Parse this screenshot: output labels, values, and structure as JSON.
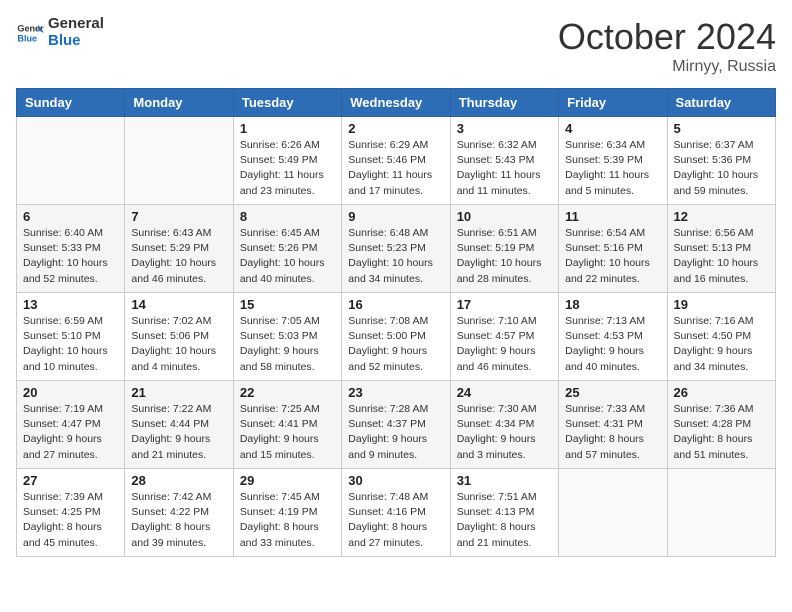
{
  "header": {
    "logo_line1": "General",
    "logo_line2": "Blue",
    "month_title": "October 2024",
    "location": "Mirnyy, Russia"
  },
  "weekdays": [
    "Sunday",
    "Monday",
    "Tuesday",
    "Wednesday",
    "Thursday",
    "Friday",
    "Saturday"
  ],
  "weeks": [
    [
      {
        "day": "",
        "info": ""
      },
      {
        "day": "",
        "info": ""
      },
      {
        "day": "1",
        "info": "Sunrise: 6:26 AM\nSunset: 5:49 PM\nDaylight: 11 hours and 23 minutes."
      },
      {
        "day": "2",
        "info": "Sunrise: 6:29 AM\nSunset: 5:46 PM\nDaylight: 11 hours and 17 minutes."
      },
      {
        "day": "3",
        "info": "Sunrise: 6:32 AM\nSunset: 5:43 PM\nDaylight: 11 hours and 11 minutes."
      },
      {
        "day": "4",
        "info": "Sunrise: 6:34 AM\nSunset: 5:39 PM\nDaylight: 11 hours and 5 minutes."
      },
      {
        "day": "5",
        "info": "Sunrise: 6:37 AM\nSunset: 5:36 PM\nDaylight: 10 hours and 59 minutes."
      }
    ],
    [
      {
        "day": "6",
        "info": "Sunrise: 6:40 AM\nSunset: 5:33 PM\nDaylight: 10 hours and 52 minutes."
      },
      {
        "day": "7",
        "info": "Sunrise: 6:43 AM\nSunset: 5:29 PM\nDaylight: 10 hours and 46 minutes."
      },
      {
        "day": "8",
        "info": "Sunrise: 6:45 AM\nSunset: 5:26 PM\nDaylight: 10 hours and 40 minutes."
      },
      {
        "day": "9",
        "info": "Sunrise: 6:48 AM\nSunset: 5:23 PM\nDaylight: 10 hours and 34 minutes."
      },
      {
        "day": "10",
        "info": "Sunrise: 6:51 AM\nSunset: 5:19 PM\nDaylight: 10 hours and 28 minutes."
      },
      {
        "day": "11",
        "info": "Sunrise: 6:54 AM\nSunset: 5:16 PM\nDaylight: 10 hours and 22 minutes."
      },
      {
        "day": "12",
        "info": "Sunrise: 6:56 AM\nSunset: 5:13 PM\nDaylight: 10 hours and 16 minutes."
      }
    ],
    [
      {
        "day": "13",
        "info": "Sunrise: 6:59 AM\nSunset: 5:10 PM\nDaylight: 10 hours and 10 minutes."
      },
      {
        "day": "14",
        "info": "Sunrise: 7:02 AM\nSunset: 5:06 PM\nDaylight: 10 hours and 4 minutes."
      },
      {
        "day": "15",
        "info": "Sunrise: 7:05 AM\nSunset: 5:03 PM\nDaylight: 9 hours and 58 minutes."
      },
      {
        "day": "16",
        "info": "Sunrise: 7:08 AM\nSunset: 5:00 PM\nDaylight: 9 hours and 52 minutes."
      },
      {
        "day": "17",
        "info": "Sunrise: 7:10 AM\nSunset: 4:57 PM\nDaylight: 9 hours and 46 minutes."
      },
      {
        "day": "18",
        "info": "Sunrise: 7:13 AM\nSunset: 4:53 PM\nDaylight: 9 hours and 40 minutes."
      },
      {
        "day": "19",
        "info": "Sunrise: 7:16 AM\nSunset: 4:50 PM\nDaylight: 9 hours and 34 minutes."
      }
    ],
    [
      {
        "day": "20",
        "info": "Sunrise: 7:19 AM\nSunset: 4:47 PM\nDaylight: 9 hours and 27 minutes."
      },
      {
        "day": "21",
        "info": "Sunrise: 7:22 AM\nSunset: 4:44 PM\nDaylight: 9 hours and 21 minutes."
      },
      {
        "day": "22",
        "info": "Sunrise: 7:25 AM\nSunset: 4:41 PM\nDaylight: 9 hours and 15 minutes."
      },
      {
        "day": "23",
        "info": "Sunrise: 7:28 AM\nSunset: 4:37 PM\nDaylight: 9 hours and 9 minutes."
      },
      {
        "day": "24",
        "info": "Sunrise: 7:30 AM\nSunset: 4:34 PM\nDaylight: 9 hours and 3 minutes."
      },
      {
        "day": "25",
        "info": "Sunrise: 7:33 AM\nSunset: 4:31 PM\nDaylight: 8 hours and 57 minutes."
      },
      {
        "day": "26",
        "info": "Sunrise: 7:36 AM\nSunset: 4:28 PM\nDaylight: 8 hours and 51 minutes."
      }
    ],
    [
      {
        "day": "27",
        "info": "Sunrise: 7:39 AM\nSunset: 4:25 PM\nDaylight: 8 hours and 45 minutes."
      },
      {
        "day": "28",
        "info": "Sunrise: 7:42 AM\nSunset: 4:22 PM\nDaylight: 8 hours and 39 minutes."
      },
      {
        "day": "29",
        "info": "Sunrise: 7:45 AM\nSunset: 4:19 PM\nDaylight: 8 hours and 33 minutes."
      },
      {
        "day": "30",
        "info": "Sunrise: 7:48 AM\nSunset: 4:16 PM\nDaylight: 8 hours and 27 minutes."
      },
      {
        "day": "31",
        "info": "Sunrise: 7:51 AM\nSunset: 4:13 PM\nDaylight: 8 hours and 21 minutes."
      },
      {
        "day": "",
        "info": ""
      },
      {
        "day": "",
        "info": ""
      }
    ]
  ]
}
